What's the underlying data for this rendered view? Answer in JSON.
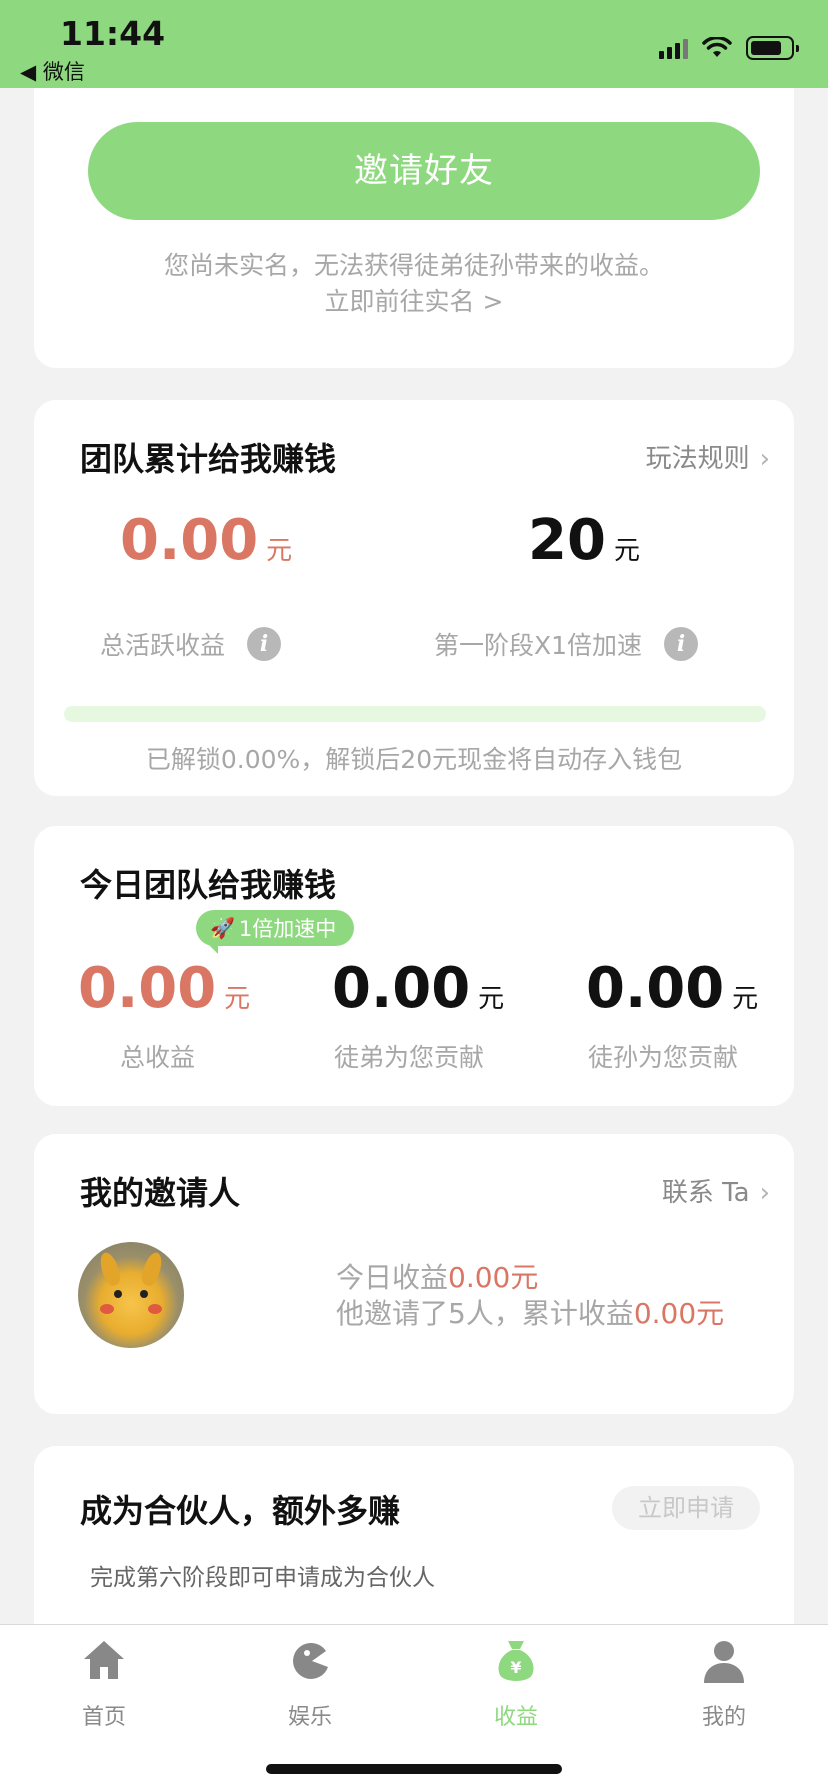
{
  "status_bar": {
    "time": "11:44",
    "back_label": "◀ 微信"
  },
  "invite": {
    "button_label": "邀请好友",
    "note_line1": "您尚未实名，无法获得徒弟徒孙带来的收益。",
    "note_line2": "立即前往实名 >"
  },
  "team_total": {
    "title": "团队累计给我赚钱",
    "rules_link": "玩法规则",
    "active_income": {
      "value": "0.00",
      "unit": "元",
      "label": "总活跃收益"
    },
    "stage_reward": {
      "value": "20",
      "unit": "元",
      "label": "第一阶段X1倍加速"
    },
    "unlock_progress_percent": 0,
    "unlock_note": "已解锁0.00%，解锁后20元现金将自动存入钱包"
  },
  "today": {
    "title": "今日团队给我赚钱",
    "boost_badge": "1倍加速中",
    "total": {
      "value": "0.00",
      "unit": "元",
      "label": "总收益"
    },
    "disciple": {
      "value": "0.00",
      "unit": "元",
      "label": "徒弟为您贡献"
    },
    "grand_disciple": {
      "value": "0.00",
      "unit": "元",
      "label": "徒孙为您贡献"
    }
  },
  "inviter": {
    "title": "我的邀请人",
    "contact_link": "联系 Ta",
    "today_label": "今日收益",
    "today_value": "0.00元",
    "invited_label": "他邀请了5人，累计收益",
    "cumulative_value": "0.00元"
  },
  "partner": {
    "title": "成为合伙人，额外多赚",
    "apply_button": "立即申请",
    "description": "完成第六阶段即可申请成为合伙人"
  },
  "tab_bar": {
    "tabs": [
      {
        "label": "首页",
        "icon": "home-icon"
      },
      {
        "label": "娱乐",
        "icon": "game-icon"
      },
      {
        "label": "收益",
        "icon": "money-bag-icon",
        "active": true
      },
      {
        "label": "我的",
        "icon": "person-icon"
      }
    ]
  },
  "colors": {
    "brand_green": "#8ed97f",
    "amount_red": "#d97764",
    "muted_text": "#a7a7a7"
  }
}
